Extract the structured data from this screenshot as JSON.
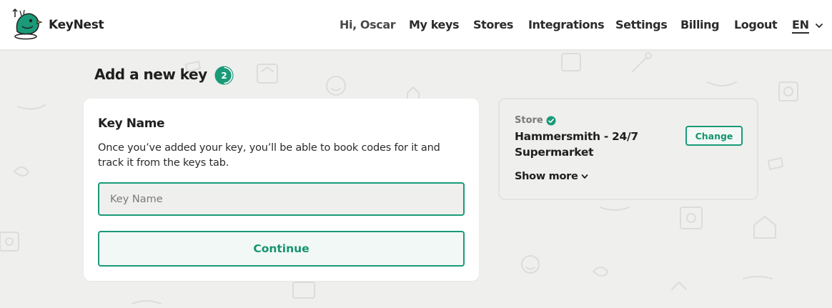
{
  "header": {
    "brand": "KeyNest",
    "greeting": "Hi, Oscar",
    "nav": [
      {
        "label": "My keys"
      },
      {
        "label": "Stores"
      },
      {
        "label": "Integrations"
      },
      {
        "label": "Settings"
      },
      {
        "label": "Billing"
      },
      {
        "label": "Logout"
      }
    ],
    "language": "EN"
  },
  "page": {
    "title": "Add a new key",
    "step": "2"
  },
  "key_form": {
    "title": "Key Name",
    "description": "Once you’ve added your key, you’ll be able to book codes for it and track it from the keys tab.",
    "input_placeholder": "Key Name",
    "input_value": "",
    "continue_label": "Continue"
  },
  "store": {
    "label": "Store",
    "name": "Hammersmith - 24/7 Supermarket",
    "change_label": "Change",
    "show_more_label": "Show more"
  },
  "colors": {
    "accent": "#1a9a78",
    "page_background": "#efefed"
  },
  "icons": {
    "logo": "bird-logo-icon",
    "verified": "check-circle-icon",
    "chevron": "chevron-down-icon"
  }
}
